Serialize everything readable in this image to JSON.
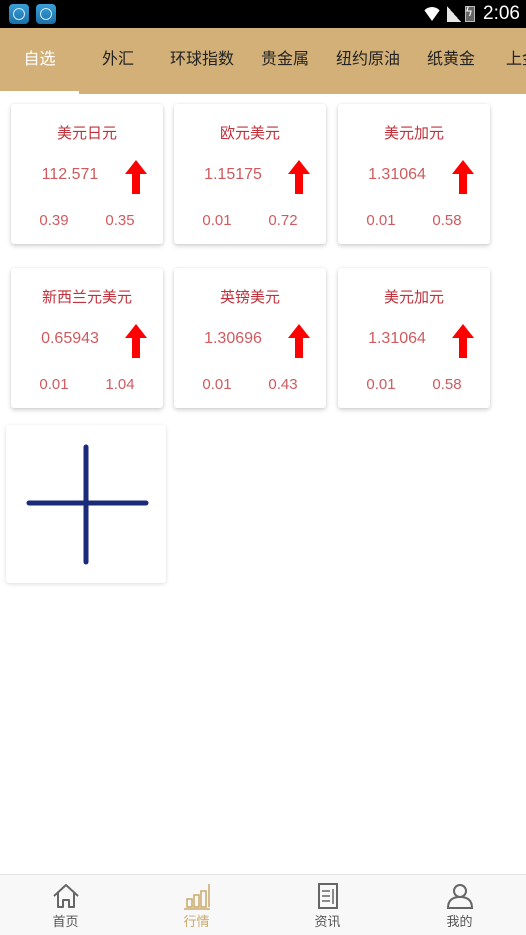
{
  "status_bar": {
    "notification_icons": [
      "nox-app-icon",
      "nox-app-icon"
    ],
    "time": "2:06",
    "icons": [
      "wifi-icon",
      "signal-icon",
      "battery-charging-icon"
    ]
  },
  "colors": {
    "tabbar_bg": "#D2B077",
    "active_tab_text": "#FFFFFF",
    "card_title": "#C0303A",
    "card_value": "#D05A5E",
    "up_arrow": "#FF0000",
    "add_icon": "#1B2A7A",
    "nav_active": "#C9A96B"
  },
  "tabs": [
    {
      "label": "自选",
      "active": true
    },
    {
      "label": "外汇",
      "active": false
    },
    {
      "label": "环球指数",
      "active": false
    },
    {
      "label": "贵金属",
      "active": false
    },
    {
      "label": "纽约原油",
      "active": false
    },
    {
      "label": "纸黄金",
      "active": false
    },
    {
      "label": "上金所",
      "active": false
    }
  ],
  "watchlist": [
    {
      "name": "美元日元",
      "price": "112.571",
      "trend": "up-arrow-icon",
      "left_value": "0.39",
      "right_value": "0.35"
    },
    {
      "name": "欧元美元",
      "price": "1.15175",
      "trend": "up-arrow-icon",
      "left_value": "0.01",
      "right_value": "0.72"
    },
    {
      "name": "美元加元",
      "price": "1.31064",
      "trend": "up-arrow-icon",
      "left_value": "0.01",
      "right_value": "0.58"
    },
    {
      "name": "新西兰元美元",
      "price": "0.65943",
      "trend": "up-arrow-icon",
      "left_value": "0.01",
      "right_value": "1.04"
    },
    {
      "name": "英镑美元",
      "price": "1.30696",
      "trend": "up-arrow-icon",
      "left_value": "0.01",
      "right_value": "0.43"
    },
    {
      "name": "美元加元",
      "price": "1.31064",
      "trend": "up-arrow-icon",
      "left_value": "0.01",
      "right_value": "0.58"
    }
  ],
  "add_button": {
    "icon": "plus-icon"
  },
  "bottom_nav": [
    {
      "label": "首页",
      "icon": "home-icon",
      "active": false
    },
    {
      "label": "行情",
      "icon": "bar-chart-icon",
      "active": true
    },
    {
      "label": "资讯",
      "icon": "news-icon",
      "active": false
    },
    {
      "label": "我的",
      "icon": "user-icon",
      "active": false
    }
  ]
}
